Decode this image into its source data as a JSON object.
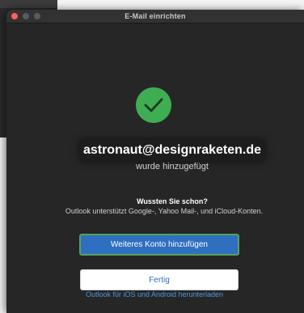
{
  "window": {
    "title": "E-Mail einrichten"
  },
  "success": {
    "icon": "checkmark-icon",
    "icon_color": "#3fae52",
    "email": "astronaut@designraketen.de",
    "message": "wurde hinzugefügt"
  },
  "tip": {
    "heading": "Wussten Sie schon?",
    "text": "Outlook unterstützt Google-, Yahoo Mail-, und iCloud-Konten."
  },
  "actions": {
    "add_account_label": "Weiteres Konto hinzufügen",
    "done_label": "Fertig",
    "download_link": "Outlook für iOS und Android herunterladen"
  },
  "colors": {
    "primary": "#2f6fbf",
    "link": "#4d97e0",
    "background": "#262626"
  }
}
